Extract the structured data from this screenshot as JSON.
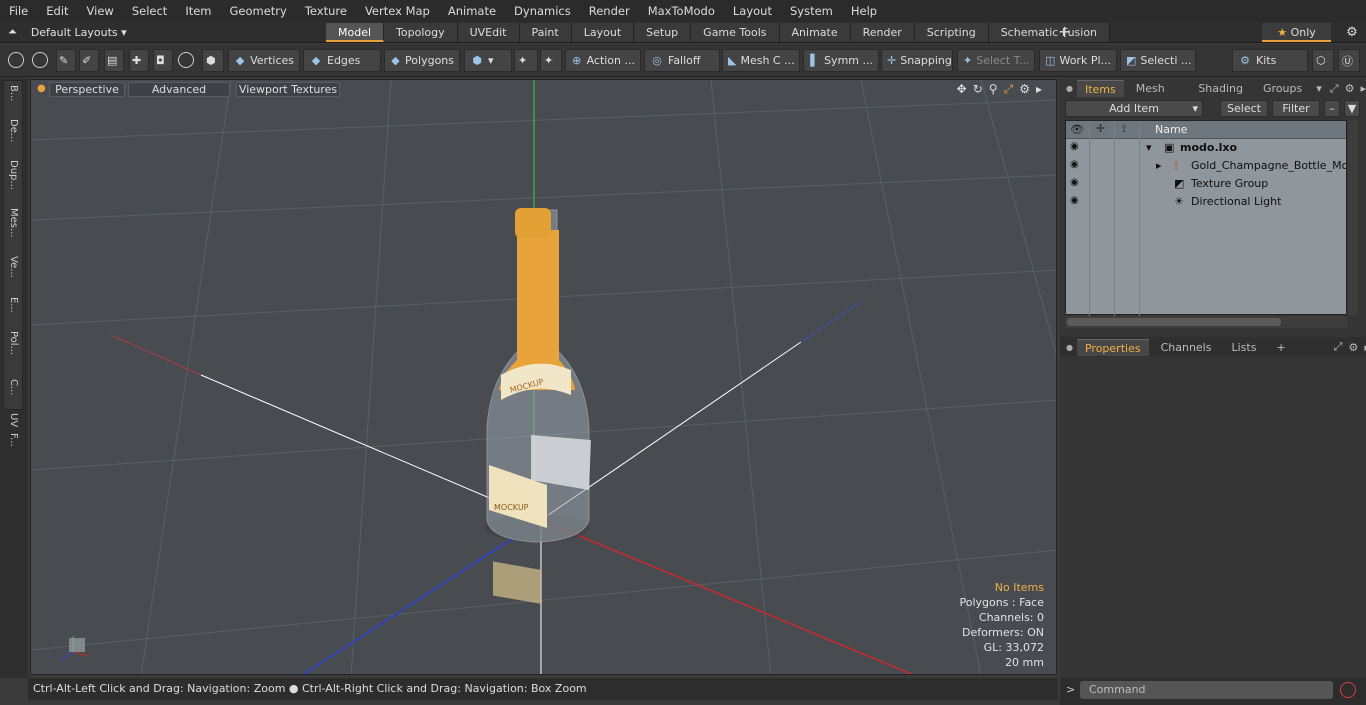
{
  "menu": [
    "File",
    "Edit",
    "View",
    "Select",
    "Item",
    "Geometry",
    "Texture",
    "Vertex Map",
    "Animate",
    "Dynamics",
    "Render",
    "MaxToModo",
    "Layout",
    "System",
    "Help"
  ],
  "layouts_label": "Default Layouts",
  "mode_tabs": [
    "Model",
    "Topology",
    "UVEdit",
    "Paint",
    "Layout",
    "Setup",
    "Game Tools",
    "Animate",
    "Render",
    "Scripting",
    "Schematic Fusion"
  ],
  "active_mode": "Model",
  "only_label": "Only",
  "toolbar": {
    "vertices": "Vertices",
    "edges": "Edges",
    "polygons": "Polygons",
    "action": "Action ...",
    "falloff": "Falloff",
    "mesh": "Mesh C ...",
    "symm": "Symm ...",
    "snapping": "Snapping",
    "select_t": "Select T...",
    "work_pl": "Work Pl...",
    "selecti": "Selecti ...",
    "kits": "Kits"
  },
  "left_tabs": [
    "B...",
    "De...",
    "Dup...",
    "Mes...",
    "Ve...",
    "E...",
    "Pol...",
    "C...",
    "UV",
    "F..."
  ],
  "viewport": {
    "perspective": "Perspective",
    "advanced": "Advanced",
    "viewport_textures": "Viewport Textures",
    "bottle_label": "MOCKUP",
    "stats": {
      "no_items": "No Items",
      "polygons": "Polygons : Face",
      "channels": "Channels: 0",
      "deformers": "Deformers: ON",
      "gl": "GL: 33,072",
      "scale": "20 mm"
    }
  },
  "status": "Ctrl-Alt-Left Click and Drag: Navigation: Zoom ● Ctrl-Alt-Right Click and Drag: Navigation: Box Zoom",
  "right_panel": {
    "tabs": [
      "Items",
      "Mesh ...",
      "Shading",
      "Groups"
    ],
    "add_item": "Add Item",
    "select": "Select",
    "filter": "Filter",
    "name_col": "Name",
    "tree": [
      {
        "label": "modo.lxo",
        "level": 0
      },
      {
        "label": "Gold_Champagne_Bottle_Mo ...",
        "level": 1
      },
      {
        "label": "Texture Group",
        "level": 1
      },
      {
        "label": "Directional Light",
        "level": 1
      }
    ],
    "prop_tabs": [
      "Properties",
      "Channels",
      "Lists"
    ],
    "command_placeholder": "Command"
  },
  "colors": {
    "accent": "#e8a13a",
    "viewport_bg": "#484c51",
    "bottle_gold": "#e8a43a"
  }
}
